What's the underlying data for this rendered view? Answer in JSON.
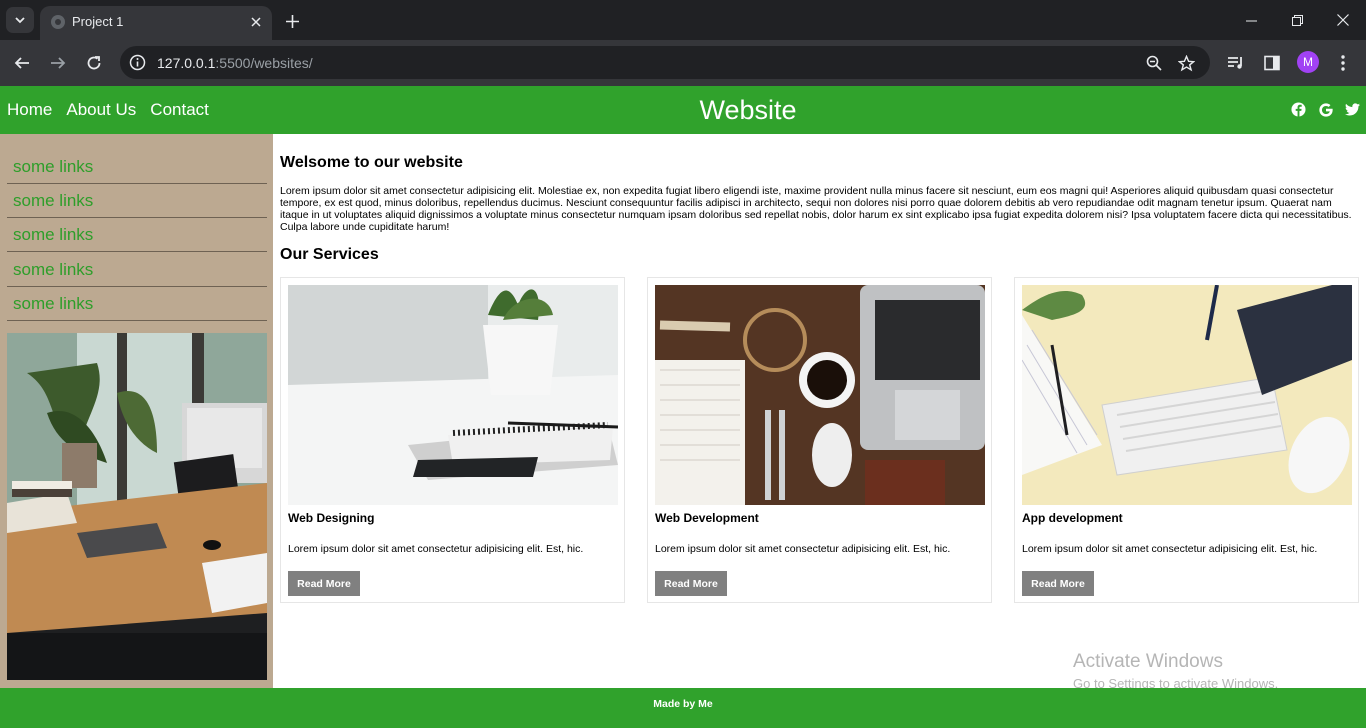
{
  "browser": {
    "tab_title": "Project 1",
    "url_host": "127.0.0.1",
    "url_rest": ":5500/websites/",
    "profile_initial": "M",
    "theme_color": "#202124"
  },
  "header": {
    "nav": [
      "Home",
      "About Us",
      "Contact"
    ],
    "title": "Website",
    "social_icons": [
      "facebook-icon",
      "google-icon",
      "twitter-icon"
    ],
    "color": "#30a22c"
  },
  "sidebar": {
    "links": [
      "some links",
      "some links",
      "some links",
      "some links",
      "some links"
    ],
    "background": "#bca991"
  },
  "main": {
    "welcome_title": "Welsome to our website",
    "intro_text": "Lorem ipsum dolor sit amet consectetur adipisicing elit. Molestiae ex, non expedita fugiat libero eligendi iste, maxime provident nulla minus facere sit nesciunt, eum eos magni qui! Asperiores aliquid quibusdam quasi consectetur tempore, ex est quod, minus doloribus, repellendus ducimus. Nesciunt consequuntur facilis adipisci in architecto, sequi non dolores nisi porro quae dolorem debitis ab vero repudiandae odit magnam tenetur ipsum. Quaerat nam itaque in ut voluptates aliquid dignissimos a voluptate minus consectetur numquam ipsam doloribus sed repellat nobis, dolor harum ex sint explicabo ipsa fugiat expedita dolorem nisi? Ipsa voluptatem facere dicta qui necessitatibus. Culpa labore unde cupiditate harum!",
    "services_title": "Our Services",
    "cards": [
      {
        "title": "Web Designing",
        "text": "Lorem ipsum dolor sit amet consectetur adipisicing elit. Est, hic.",
        "button": "Read More"
      },
      {
        "title": "Web Development",
        "text": "Lorem ipsum dolor sit amet consectetur adipisicing elit. Est, hic.",
        "button": "Read More"
      },
      {
        "title": "App development",
        "text": "Lorem ipsum dolor sit amet consectetur adipisicing elit. Est, hic.",
        "button": "Read More"
      }
    ]
  },
  "watermark": {
    "line1": "Activate Windows",
    "line2": "Go to Settings to activate Windows."
  },
  "footer": {
    "text": "Made by Me"
  }
}
